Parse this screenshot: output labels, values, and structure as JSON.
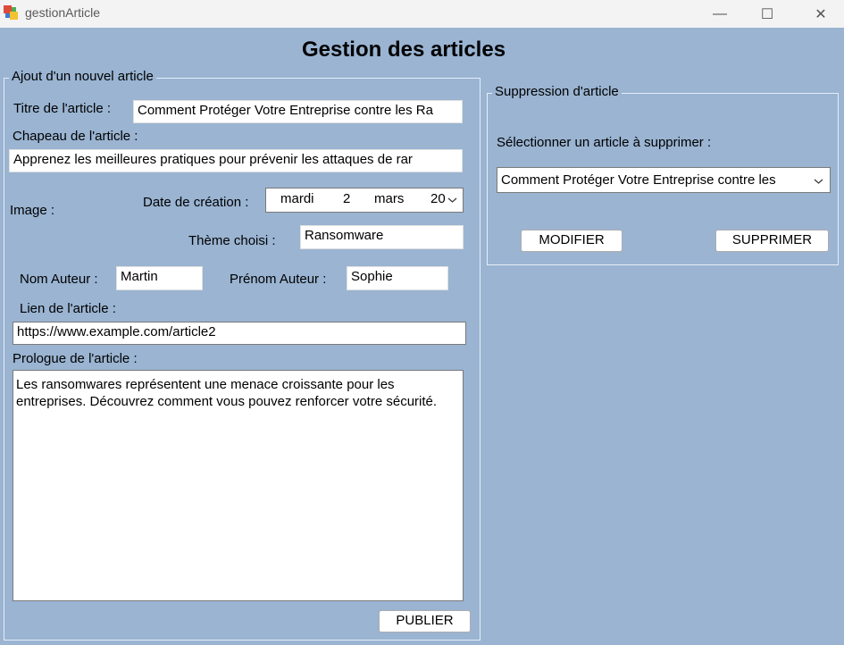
{
  "window": {
    "title": "gestionArticle",
    "minimize": "—",
    "maximize": "☐",
    "close": "✕"
  },
  "heading": "Gestion des articles",
  "add_group": {
    "legend": "Ajout d'un nouvel article",
    "titre_label": "Titre de l'article :",
    "titre_value": "Comment Protéger Votre Entreprise contre les Ra",
    "chapeau_label": "Chapeau de l'article :",
    "chapeau_value": "Apprenez les meilleures pratiques pour prévenir les attaques de rar",
    "image_label": "Image  :",
    "date_label": "Date de création :",
    "date": {
      "weekday": "mardi",
      "day": "2",
      "month": "mars",
      "year": "20"
    },
    "theme_label": "Thème choisi :",
    "theme_value": "Ransomware",
    "nom_label": "Nom Auteur :",
    "nom_value": "Martin",
    "prenom_label": "Prénom Auteur :",
    "prenom_value": "Sophie",
    "lien_label": "Lien de l'article :",
    "lien_value": "https://www.example.com/article2",
    "prologue_label": "Prologue de l'article :",
    "prologue_value": "Les ransomwares représentent une menace croissante pour les entreprises. Découvrez comment vous pouvez renforcer votre sécurité.",
    "publish_label": "PUBLIER"
  },
  "delete_group": {
    "legend": "Suppression d'article",
    "select_label": "Sélectionner un article à supprimer :",
    "selected_article": "Comment Protéger Votre Entreprise contre les",
    "modify_label": "MODIFIER",
    "delete_label": "SUPPRIMER"
  }
}
